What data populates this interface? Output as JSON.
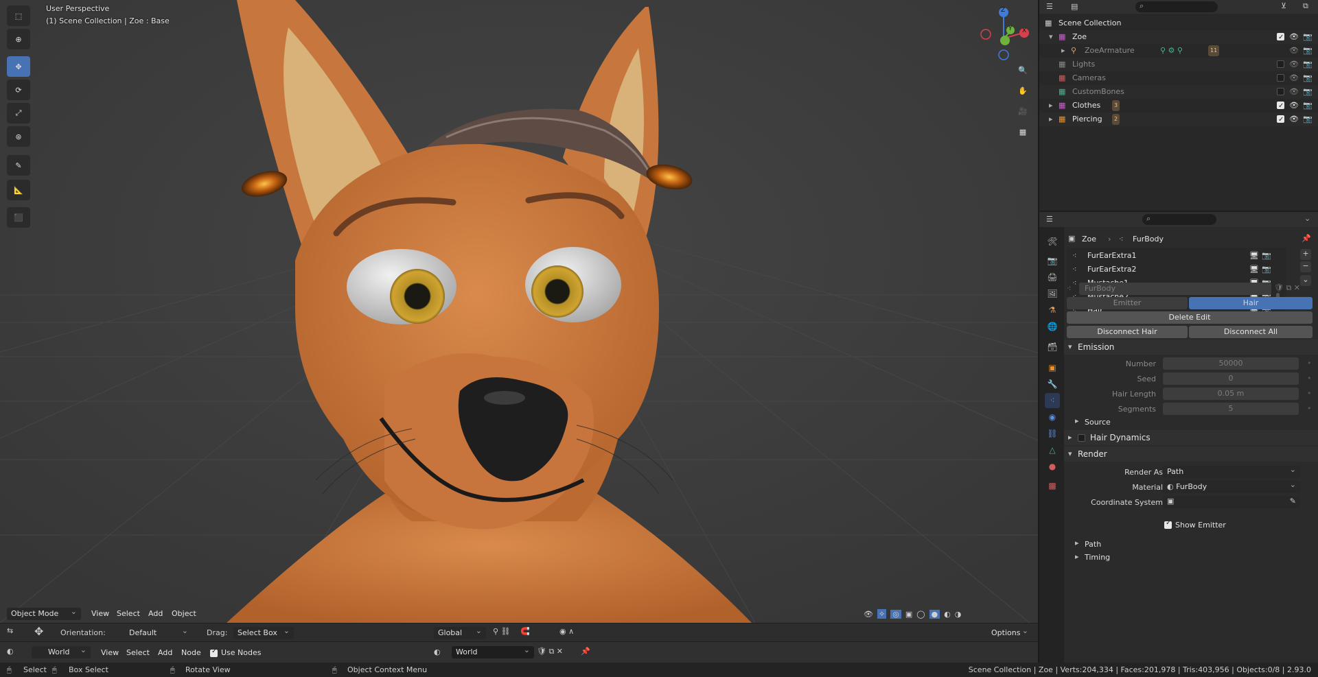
{
  "viewport": {
    "perspective_label": "User Perspective",
    "collection_label": "(1) Scene Collection | Zoe  : Base",
    "header": {
      "mode": "Object Mode",
      "menus": [
        "View",
        "Select",
        "Add",
        "Object"
      ]
    },
    "gizmo": {
      "x": "X",
      "y": "Y",
      "z": "Z"
    }
  },
  "tool_settings": {
    "orientation_label": "Orientation:",
    "orientation_value": "Default",
    "drag_label": "Drag:",
    "drag_value": "Select Box",
    "transform_space": "Global",
    "options_label": "Options"
  },
  "node_editor": {
    "world_type": "World",
    "menus": [
      "View",
      "Select",
      "Add",
      "Node"
    ],
    "use_nodes_label": "Use Nodes",
    "world_name": "World"
  },
  "outliner": {
    "rows": [
      {
        "name": "Scene Collection"
      },
      {
        "name": "Zoe"
      },
      {
        "name": "ZoeArmature",
        "count": "11"
      },
      {
        "name": "Lights"
      },
      {
        "name": "Cameras"
      },
      {
        "name": "CustomBones"
      },
      {
        "name": "Clothes",
        "count": "3"
      },
      {
        "name": "Piercing",
        "count": "2"
      }
    ]
  },
  "properties": {
    "breadcrumb": {
      "object": "Zoe",
      "sep": "›",
      "data": "FurBody"
    },
    "particle_list": [
      "FurEarExtra1",
      "FurEarExtra2",
      "Mustache1",
      "Mustache2",
      "Hair"
    ],
    "settings_name": "FurBody",
    "type_emitter": "Emitter",
    "type_hair": "Hair",
    "delete_edit": "Delete Edit",
    "disconnect_hair": "Disconnect Hair",
    "disconnect_all": "Disconnect All",
    "emission": {
      "title": "Emission",
      "fields": [
        {
          "label": "Number",
          "value": "50000"
        },
        {
          "label": "Seed",
          "value": "0"
        },
        {
          "label": "Hair Length",
          "value": "0.05 m"
        },
        {
          "label": "Segments",
          "value": "5"
        }
      ],
      "source": "Source"
    },
    "hair_dynamics": "Hair Dynamics",
    "render": {
      "title": "Render",
      "render_as_label": "Render As",
      "render_as_value": "Path",
      "material_label": "Material",
      "material_value": "FurBody",
      "coord_label": "Coordinate System",
      "show_emitter": "Show Emitter",
      "path": "Path",
      "timing": "Timing"
    }
  },
  "status": {
    "select": "Select",
    "box_select": "Box Select",
    "rotate_view": "Rotate View",
    "context_menu": "Object Context Menu",
    "stats": "Scene Collection | Zoe | Verts:204,334 | Faces:201,978 | Tris:403,956 | Objects:0/8 | 2.93.0"
  },
  "colors": {
    "accent": "#4772b3",
    "fur": "#c8763c",
    "collection": "#f5f5f5"
  }
}
